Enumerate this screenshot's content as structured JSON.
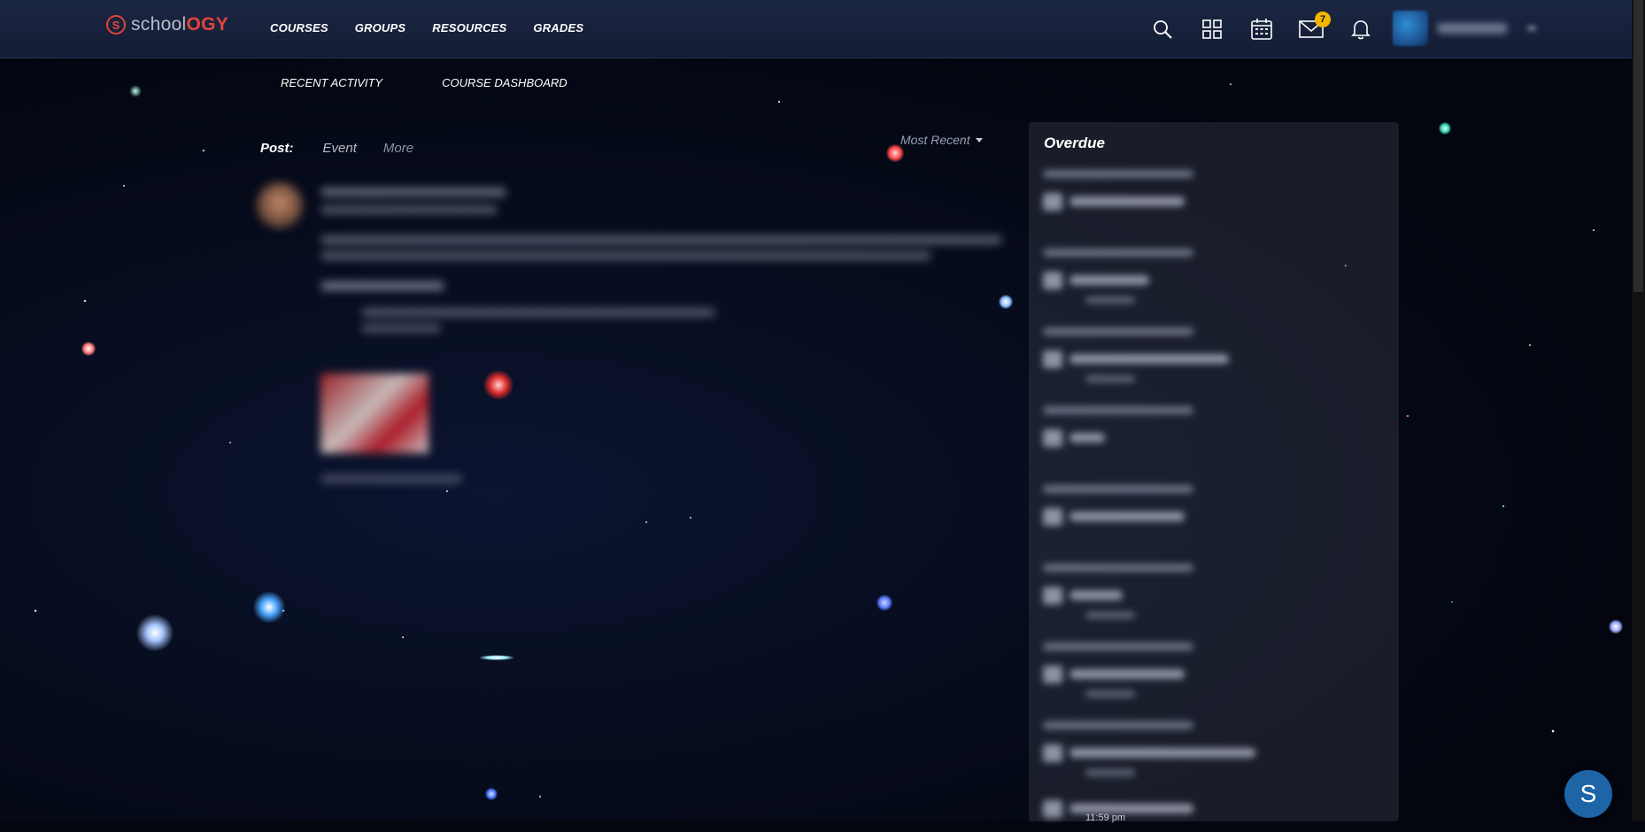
{
  "brand": {
    "logo_mark": "S",
    "name_prefix": "schoo",
    "name_suffix": "l",
    "name_bold": "OGY",
    "accent": "#e2453c"
  },
  "nav": {
    "items": [
      "COURSES",
      "GROUPS",
      "RESOURCES",
      "GRADES"
    ]
  },
  "tools": {
    "messages_badge": "7"
  },
  "subnav": {
    "recent_activity": "RECENT ACTIVITY",
    "course_dashboard": "COURSE DASHBOARD"
  },
  "post": {
    "label": "Post:",
    "event_tab": "Event",
    "more_tab": "More"
  },
  "sort": {
    "label": "Most Recent"
  },
  "sidebar": {
    "title": "Overdue",
    "tail_time": "11:59 pm"
  },
  "help": {
    "label": "S"
  },
  "colors": {
    "topbar": "#1b2642",
    "badge": "#f2b600",
    "help": "#1d65a6"
  }
}
